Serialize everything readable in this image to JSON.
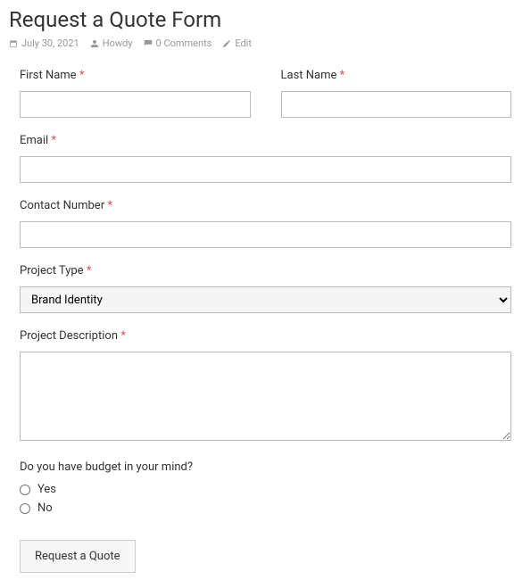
{
  "header": {
    "title": "Request a Quote Form",
    "meta": {
      "date": "July 30, 2021",
      "author": "Howdy",
      "comments": "0 Comments",
      "edit": "Edit"
    }
  },
  "form": {
    "first_name": {
      "label": "First Name",
      "required": "*",
      "value": ""
    },
    "last_name": {
      "label": "Last Name",
      "required": "*",
      "value": ""
    },
    "email": {
      "label": "Email",
      "required": "*",
      "value": ""
    },
    "contact_number": {
      "label": "Contact Number",
      "required": "*",
      "value": ""
    },
    "project_type": {
      "label": "Project Type",
      "required": "*",
      "selected": "Brand Identity"
    },
    "project_description": {
      "label": "Project Description",
      "required": "*",
      "value": ""
    },
    "budget": {
      "label": "Do you have budget in your mind?",
      "options": {
        "yes": "Yes",
        "no": "No"
      }
    },
    "submit_label": "Request a Quote"
  }
}
